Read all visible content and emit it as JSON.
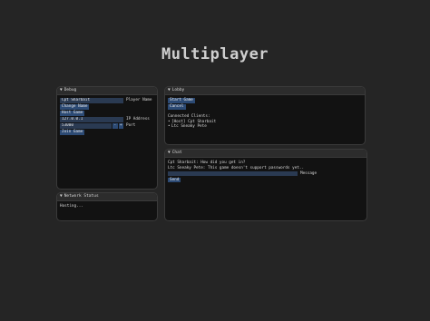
{
  "title": "Multiplayer",
  "debug": {
    "header": "Debug",
    "player_name_value": "Cpt Sharbait",
    "player_name_label": "Player Name",
    "change_name_label": "Change Name",
    "host_game_label": "Host Game",
    "ip_value": "127.0.0.1",
    "ip_label": "IP Address",
    "port_value": "53000",
    "port_minus": "-",
    "port_plus": "+",
    "port_label": "Port",
    "join_game_label": "Join Game"
  },
  "network": {
    "header": "Network Status",
    "status": "Hosting..."
  },
  "lobby": {
    "header": "Lobby",
    "start_game_label": "Start Game",
    "cancel_label": "Cancel",
    "clients_heading": "Connected Clients:",
    "clients": [
      "[Host] Cpt Sharbait",
      "Ltc Sneaky Pete"
    ]
  },
  "chat": {
    "header": "Chat",
    "messages": [
      "Cpt Sharbait: How did you get in?",
      "Ltc Sneaky Pete: This game doesn't support passwords yet.."
    ],
    "message_label": "Message",
    "send_label": "Send"
  }
}
